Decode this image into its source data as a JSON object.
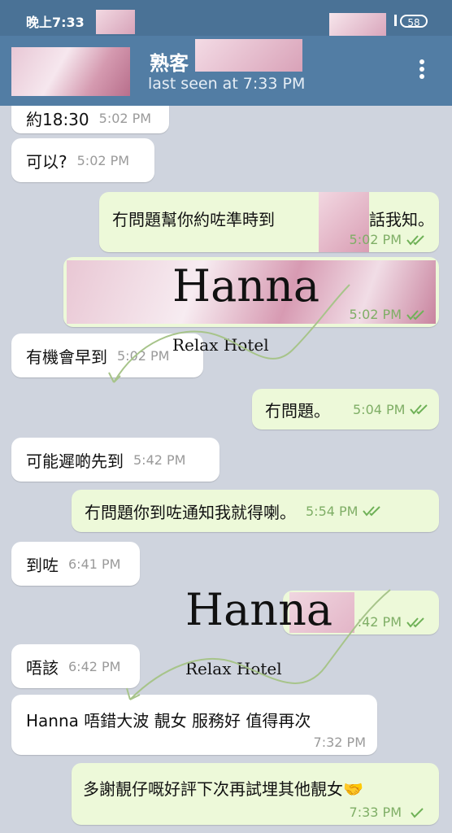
{
  "status_bar": {
    "time": "晚上7:33",
    "battery": "58"
  },
  "header": {
    "contact_name": "熟客",
    "last_seen": "last seen at 7:33 PM"
  },
  "messages": [
    {
      "direction": "in",
      "text": "約18:30",
      "time": "5:02 PM"
    },
    {
      "direction": "in",
      "text": "可以?",
      "time": "5:02 PM"
    },
    {
      "direction": "out",
      "text": "冇問題幫你約咗準時到",
      "text_after": "話我知。",
      "time": "5:02 PM",
      "status": "read"
    },
    {
      "direction": "out",
      "text": "",
      "time": "5:02 PM",
      "status": "read"
    },
    {
      "direction": "in",
      "text": "有機會早到",
      "time": "5:02 PM"
    },
    {
      "direction": "out",
      "text": "冇問題。",
      "time": "5:04 PM",
      "status": "read"
    },
    {
      "direction": "in",
      "text": "可能遲啲先到",
      "time": "5:42 PM"
    },
    {
      "direction": "out",
      "text": "冇問題你到咗通知我就得喇。",
      "time": "5:54 PM",
      "status": "read"
    },
    {
      "direction": "in",
      "text": "到咗",
      "time": "6:41 PM"
    },
    {
      "direction": "out",
      "text": "",
      "time": ":42 PM",
      "status": "read"
    },
    {
      "direction": "in",
      "text": "唔該",
      "time": "6:42 PM"
    },
    {
      "direction": "in",
      "text": "Hanna 唔錯大波 靚女 服務好 值得再次",
      "time": "7:32 PM"
    },
    {
      "direction": "out",
      "text": "多謝靚仔嘅好評下次再試埋其他靚女🤝",
      "time": "7:33 PM",
      "status": "sent"
    }
  ],
  "watermarks": [
    {
      "title": "Hanna",
      "subtitle": "Relax Hotel"
    },
    {
      "title": "Hanna",
      "subtitle": "Relax Hotel"
    }
  ],
  "icons": {
    "menu": "more-vert-icon",
    "read_receipt": "double-check-icon",
    "sent_receipt": "check-icon",
    "signal": "signal-icon",
    "battery": "battery-icon"
  },
  "colors": {
    "header": "#527da4",
    "status_bar": "#4a7296",
    "incoming_bubble": "#ffffff",
    "outgoing_bubble": "#edf9d9",
    "tick_green": "#6fb157"
  }
}
